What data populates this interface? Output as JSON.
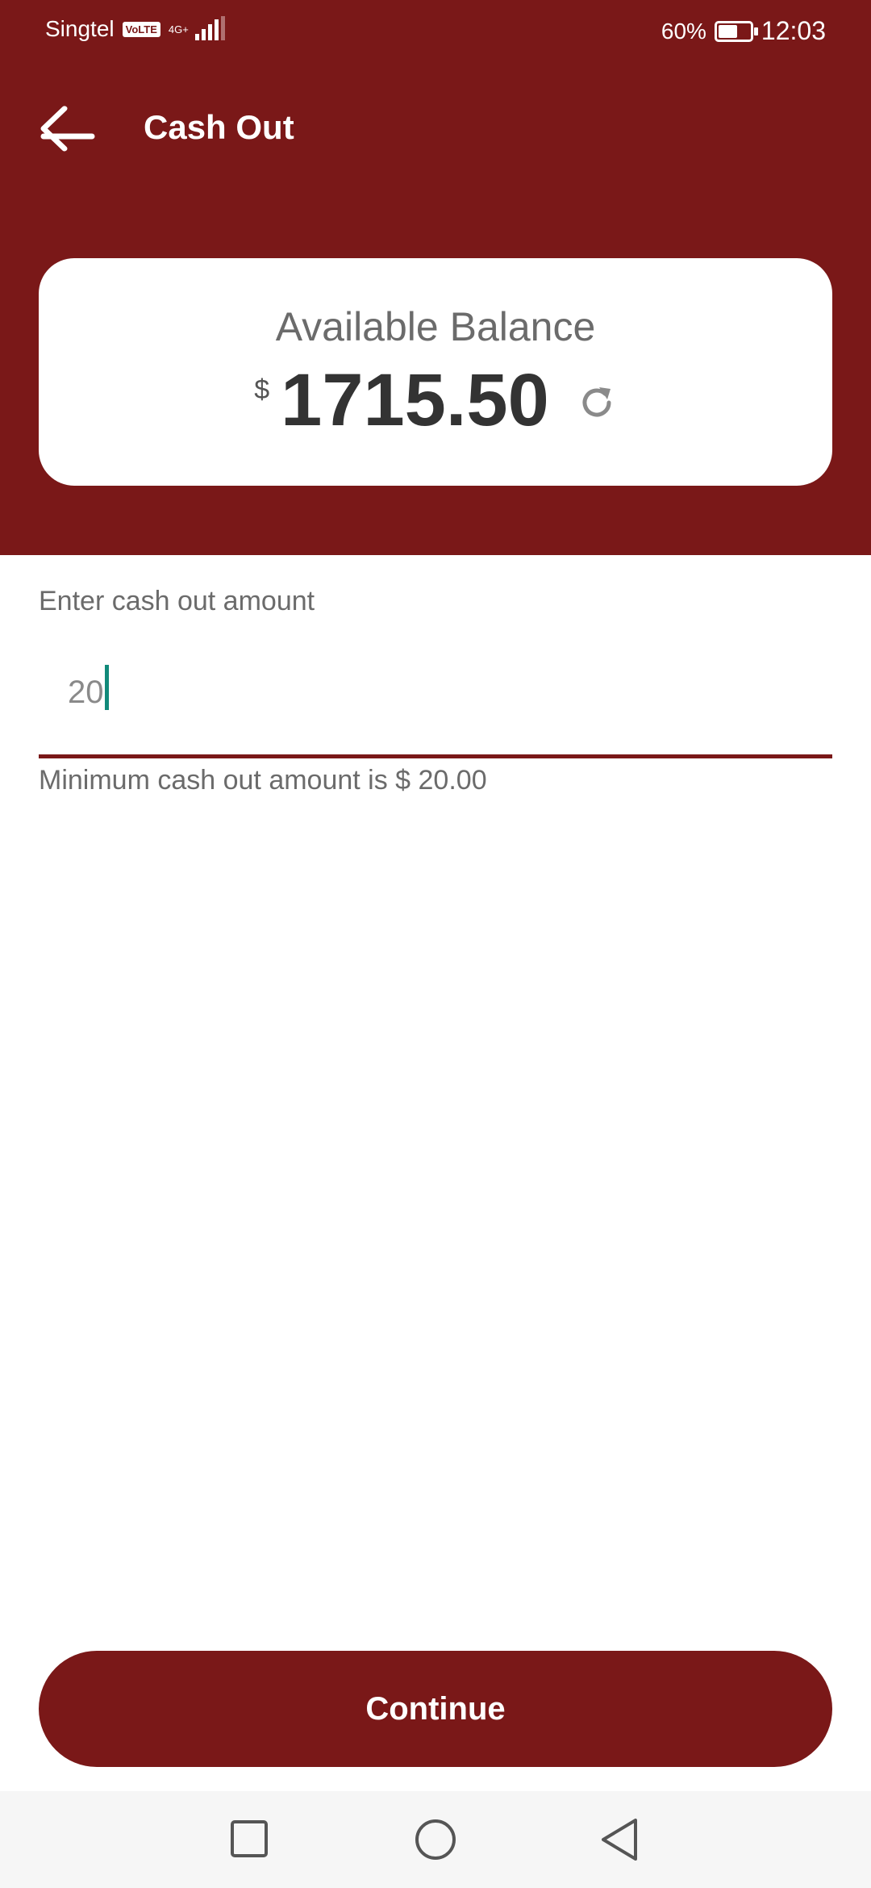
{
  "status_bar": {
    "carrier": "Singtel",
    "volte": "VoLTE",
    "network": "4G+",
    "battery_percent": "60%",
    "battery_level": 0.6,
    "time": "12:03"
  },
  "app_bar": {
    "title": "Cash Out",
    "back_icon": "arrow-left-icon"
  },
  "balance": {
    "label": "Available Balance",
    "currency": "$",
    "amount": "1715.50",
    "refresh_icon": "refresh-icon"
  },
  "cash_out": {
    "label": "Enter cash out amount",
    "value": "20",
    "helper": "Minimum cash out amount is $ 20.00"
  },
  "actions": {
    "continue_label": "Continue"
  },
  "nav_bar": {
    "recents_icon": "square-icon",
    "home_icon": "circle-icon",
    "back_icon": "triangle-back-icon"
  },
  "colors": {
    "brand": "#7a1818",
    "caret": "#118a7a",
    "text_muted": "#6b6b6b",
    "text_dark": "#333333"
  }
}
